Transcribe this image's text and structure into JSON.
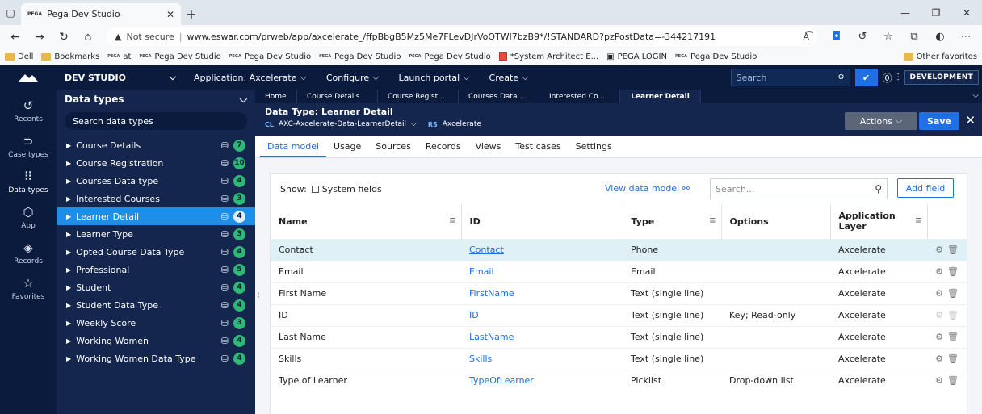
{
  "browser": {
    "tab_title": "Pega Dev Studio",
    "tab_favicon": "PEGA",
    "url_warning": "Not secure",
    "url": "www.eswar.com/prweb/app/axcelerate_/ffpBbgB5Mz5Me7FLevDJrVoQTWl7bzB9*/!STANDARD?pzPostData=-344217191",
    "bookmarks": [
      {
        "label": "Dell",
        "icon": "folder-icon"
      },
      {
        "label": "Bookmarks",
        "icon": "folder-icon"
      },
      {
        "label": "at",
        "icon": "pega-icon"
      },
      {
        "label": "Pega Dev Studio",
        "icon": "pega-icon"
      },
      {
        "label": "Pega Dev Studio",
        "icon": "pega-icon"
      },
      {
        "label": "Pega Dev Studio",
        "icon": "pega-icon"
      },
      {
        "label": "Pega Dev Studio",
        "icon": "pega-icon"
      },
      {
        "label": "*System Architect E...",
        "icon": "pdf-icon"
      },
      {
        "label": "PEGA LOGIN",
        "icon": "page-icon"
      },
      {
        "label": "Pega Dev Studio",
        "icon": "pega-icon"
      }
    ],
    "other_favorites": "Other favorites"
  },
  "header": {
    "studio": "DEV STUDIO",
    "application": "Application: Axcelerate",
    "configure": "Configure",
    "launch_portal": "Launch portal",
    "create": "Create",
    "search_placeholder": "Search",
    "environment": "DEVELOPMENT"
  },
  "leftnav": [
    {
      "label": "Recents",
      "icon": "history-icon"
    },
    {
      "label": "Case types",
      "icon": "case-types-icon"
    },
    {
      "label": "Data types",
      "icon": "grid-icon"
    },
    {
      "label": "App",
      "icon": "app-icon"
    },
    {
      "label": "Records",
      "icon": "records-icon"
    },
    {
      "label": "Favorites",
      "icon": "star-icon"
    }
  ],
  "explorer": {
    "title": "Data types",
    "search_placeholder": "Search data types",
    "items": [
      {
        "label": "Course Details",
        "count": "7"
      },
      {
        "label": "Course Registration",
        "count": "10"
      },
      {
        "label": "Courses Data type",
        "count": "4"
      },
      {
        "label": "Interested Courses",
        "count": "3"
      },
      {
        "label": "Learner Detail",
        "count": "4"
      },
      {
        "label": "Learner Type",
        "count": "3"
      },
      {
        "label": "Opted Course Data Type",
        "count": "4"
      },
      {
        "label": "Professional",
        "count": "5"
      },
      {
        "label": "Student",
        "count": "4"
      },
      {
        "label": "Student Data Type",
        "count": "4"
      },
      {
        "label": "Weekly Score",
        "count": "3"
      },
      {
        "label": "Working Women",
        "count": "4"
      },
      {
        "label": "Working Women Data Type",
        "count": "4"
      }
    ]
  },
  "work_tabs": [
    "Home",
    "Course Details",
    "Course Regist...",
    "Courses Data ...",
    "Interested Co...",
    "Learner Detail"
  ],
  "rule": {
    "title": "Data Type:  Learner Detail",
    "cl_tag": "CL",
    "class": "AXC-Axcelerate-Data-LearnerDetail",
    "rs_tag": "RS",
    "ruleset": "Axcelerate",
    "actions": "Actions",
    "save": "Save"
  },
  "rule_tabs": [
    "Data model",
    "Usage",
    "Sources",
    "Records",
    "Views",
    "Test cases",
    "Settings"
  ],
  "panel": {
    "show_label": "Show:",
    "system_fields": "System fields",
    "view_data_model": "View data model",
    "search_placeholder": "Search...",
    "add_field": "Add field",
    "columns": [
      "Name",
      "ID",
      "Type",
      "Options",
      "Application Layer"
    ],
    "rows": [
      {
        "name": "Contact",
        "id": "Contact",
        "type": "Phone",
        "options": "",
        "layer": "Axcelerate"
      },
      {
        "name": "Email",
        "id": "Email",
        "type": "Email",
        "options": "",
        "layer": "Axcelerate"
      },
      {
        "name": "First Name",
        "id": "FirstName",
        "type": "Text (single line)",
        "options": "",
        "layer": "Axcelerate"
      },
      {
        "name": "ID",
        "id": "ID",
        "type": "Text (single line)",
        "options": "Key; Read-only",
        "layer": "Axcelerate"
      },
      {
        "name": "Last Name",
        "id": "LastName",
        "type": "Text (single line)",
        "options": "",
        "layer": "Axcelerate"
      },
      {
        "name": "Skills",
        "id": "Skills",
        "type": "Text (single line)",
        "options": "",
        "layer": "Axcelerate"
      },
      {
        "name": "Type of Learner",
        "id": "TypeOfLearner",
        "type": "Picklist",
        "options": "Drop-down list",
        "layer": "Axcelerate"
      }
    ]
  },
  "colors": {
    "navy": "#0a1b3d",
    "panel_navy": "#14264d",
    "accent": "#1f6fe5",
    "selection": "#1e8fe8",
    "badge_green": "#2fb875"
  }
}
